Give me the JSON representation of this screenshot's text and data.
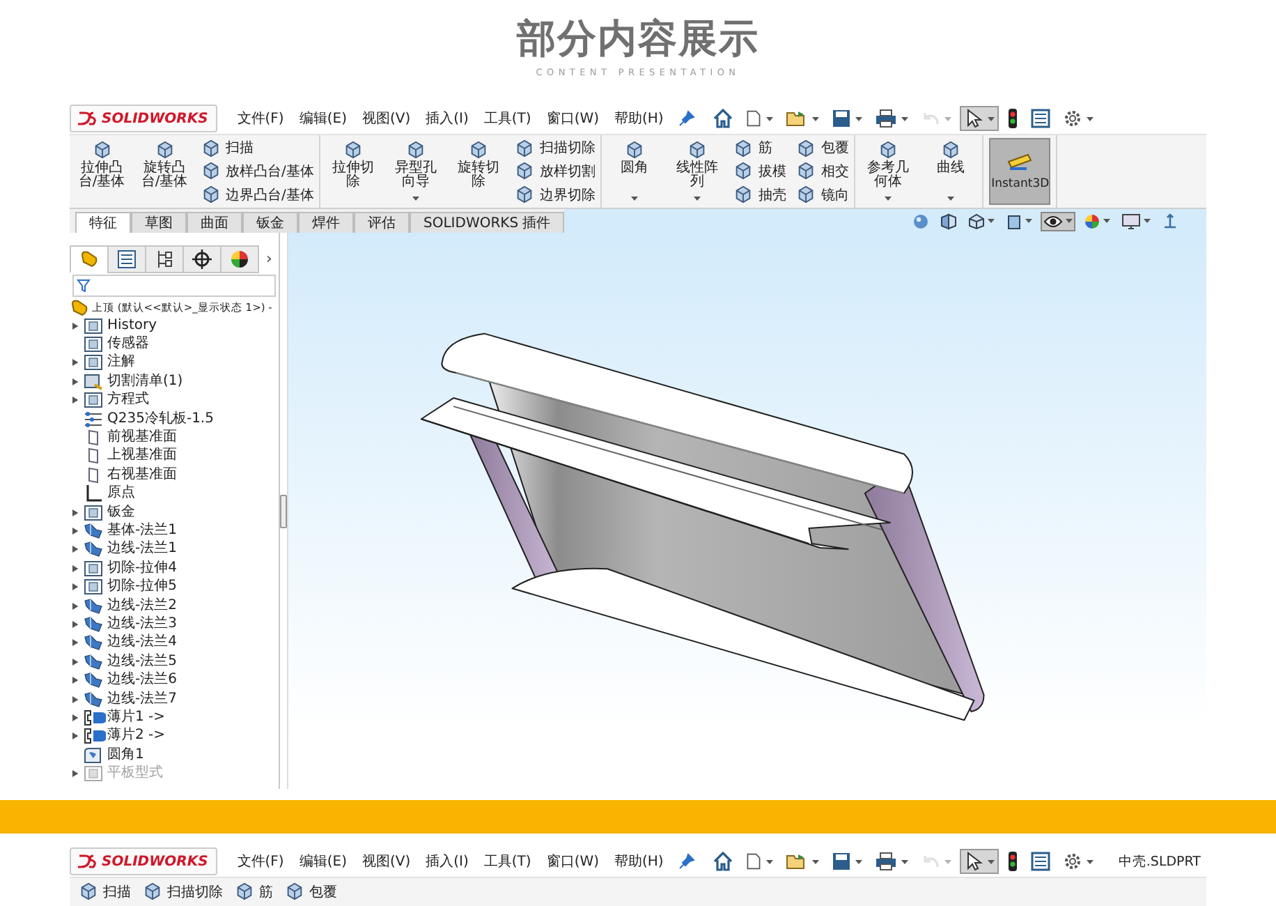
{
  "header": {
    "title": "部分内容展示",
    "subtitle": "CONTENT PRESENTATION"
  },
  "screen_1": {
    "menubar": {
      "logo": "SOLIDWORKS",
      "menus": [
        "文件(F)",
        "编辑(E)",
        "视图(V)",
        "插入(I)",
        "工具(T)",
        "窗口(W)",
        "帮助(H)"
      ],
      "quick_access": [
        {
          "kind": "home",
          "dropdown": false,
          "selected": false,
          "disabled": false
        },
        {
          "kind": "new",
          "dropdown": true,
          "selected": false,
          "disabled": false
        },
        {
          "kind": "open",
          "dropdown": true,
          "selected": false,
          "disabled": false
        },
        {
          "kind": "save",
          "dropdown": true,
          "selected": false,
          "disabled": false
        },
        {
          "kind": "print",
          "dropdown": true,
          "selected": false,
          "disabled": false
        },
        {
          "kind": "undo",
          "dropdown": true,
          "selected": false,
          "disabled": true
        },
        {
          "kind": "select",
          "dropdown": true,
          "selected": true,
          "disabled": false
        },
        {
          "kind": "rebuild",
          "dropdown": false,
          "selected": false,
          "disabled": false
        },
        {
          "kind": "file-properties",
          "dropdown": false,
          "selected": false,
          "disabled": false
        },
        {
          "kind": "options",
          "dropdown": true,
          "selected": false,
          "disabled": false
        }
      ]
    },
    "ribbon": {
      "groups": [
        {
          "columns": [
            {
              "kind": "large",
              "label": "拉伸凸台/基体",
              "dropdown": false
            },
            {
              "kind": "large",
              "label": "旋转凸台/基体",
              "dropdown": false
            },
            {
              "kind": "small",
              "items": [
                "扫描",
                "放样凸台/基体",
                "边界凸台/基体"
              ]
            }
          ]
        },
        {
          "columns": [
            {
              "kind": "large",
              "label": "拉伸切除",
              "dropdown": false
            },
            {
              "kind": "large",
              "label": "异型孔向导",
              "dropdown": true
            },
            {
              "kind": "large",
              "label": "旋转切除",
              "dropdown": false
            },
            {
              "kind": "small",
              "items": [
                "扫描切除",
                "放样切割",
                "边界切除"
              ]
            }
          ]
        },
        {
          "columns": [
            {
              "kind": "large",
              "label": "圆角",
              "dropdown": true
            },
            {
              "kind": "large",
              "label": "线性阵列",
              "dropdown": true
            },
            {
              "kind": "small",
              "items": [
                "筋",
                "拔模",
                "抽壳"
              ]
            },
            {
              "kind": "small",
              "items": [
                "包覆",
                "相交",
                "镜向"
              ]
            }
          ]
        },
        {
          "columns": [
            {
              "kind": "large",
              "label": "参考几何体",
              "dropdown": true
            },
            {
              "kind": "large",
              "label": "曲线",
              "dropdown": true
            }
          ]
        },
        {
          "columns": [
            {
              "kind": "toggle",
              "label": "Instant3D",
              "selected": true
            }
          ]
        }
      ]
    },
    "tabs": [
      {
        "label": "特征",
        "selected": true
      },
      {
        "label": "草图",
        "selected": false
      },
      {
        "label": "曲面",
        "selected": false
      },
      {
        "label": "钣金",
        "selected": false
      },
      {
        "label": "焊件",
        "selected": false
      },
      {
        "label": "评估",
        "selected": false
      },
      {
        "label": "SOLIDWORKS 插件",
        "selected": false
      }
    ],
    "view_toolbar": [
      {
        "kind": "zoom",
        "dropdown": false,
        "selected": false
      },
      {
        "kind": "section",
        "dropdown": false,
        "selected": false
      },
      {
        "kind": "orientation",
        "dropdown": true,
        "selected": false
      },
      {
        "kind": "display",
        "dropdown": true,
        "selected": false
      },
      {
        "kind": "hide-show",
        "dropdown": true,
        "selected": true
      },
      {
        "kind": "appearance",
        "dropdown": true,
        "selected": false
      },
      {
        "kind": "scene",
        "dropdown": true,
        "selected": false
      },
      {
        "kind": "triad",
        "dropdown": false,
        "selected": false
      }
    ],
    "feature_tree": {
      "panel_tabs": [
        {
          "kind": "features",
          "selected": true
        },
        {
          "kind": "properties",
          "selected": false
        },
        {
          "kind": "configurations",
          "selected": false
        },
        {
          "kind": "dimxpert",
          "selected": false
        },
        {
          "kind": "display",
          "selected": false
        }
      ],
      "more": "›",
      "root": "上顶  (默认<<默认>_显示状态 1>) -",
      "items": [
        {
          "label": "History",
          "kind": "folder",
          "expandable": true,
          "disabled": false
        },
        {
          "label": "传感器",
          "kind": "folder",
          "expandable": false,
          "disabled": false
        },
        {
          "label": "注解",
          "kind": "folder",
          "expandable": true,
          "disabled": false
        },
        {
          "label": "切割清单(1)",
          "kind": "cutlist",
          "expandable": true,
          "disabled": false
        },
        {
          "label": "方程式",
          "kind": "folder",
          "expandable": true,
          "disabled": false
        },
        {
          "label": "Q235冷轧板-1.5",
          "kind": "material",
          "expandable": false,
          "disabled": false
        },
        {
          "label": "前视基准面",
          "kind": "plane",
          "expandable": false,
          "disabled": false
        },
        {
          "label": "上视基准面",
          "kind": "plane",
          "expandable": false,
          "disabled": false
        },
        {
          "label": "右视基准面",
          "kind": "plane",
          "expandable": false,
          "disabled": false
        },
        {
          "label": "原点",
          "kind": "origin",
          "expandable": false,
          "disabled": false
        },
        {
          "label": "钣金",
          "kind": "folder",
          "expandable": true,
          "disabled": false
        },
        {
          "label": "基体-法兰1",
          "kind": "flange",
          "expandable": true,
          "disabled": false
        },
        {
          "label": "边线-法兰1",
          "kind": "flange",
          "expandable": true,
          "disabled": false
        },
        {
          "label": "切除-拉伸4",
          "kind": "folder",
          "expandable": true,
          "disabled": false
        },
        {
          "label": "切除-拉伸5",
          "kind": "folder",
          "expandable": true,
          "disabled": false
        },
        {
          "label": "边线-法兰2",
          "kind": "flange",
          "expandable": true,
          "disabled": false
        },
        {
          "label": "边线-法兰3",
          "kind": "flange",
          "expandable": true,
          "disabled": false
        },
        {
          "label": "边线-法兰4",
          "kind": "flange",
          "expandable": true,
          "disabled": false
        },
        {
          "label": "边线-法兰5",
          "kind": "flange",
          "expandable": true,
          "disabled": false
        },
        {
          "label": "边线-法兰6",
          "kind": "flange",
          "expandable": true,
          "disabled": false
        },
        {
          "label": "边线-法兰7",
          "kind": "flange",
          "expandable": true,
          "disabled": false
        },
        {
          "label": "薄片1 ->",
          "kind": "tab",
          "expandable": true,
          "disabled": false
        },
        {
          "label": "薄片2 ->",
          "kind": "tab",
          "expandable": true,
          "disabled": false
        },
        {
          "label": "圆角1",
          "kind": "fillet",
          "expandable": false,
          "disabled": false
        },
        {
          "label": "平板型式",
          "kind": "folder",
          "expandable": true,
          "disabled": true
        }
      ]
    }
  },
  "screen_2": {
    "menubar": {
      "logo": "SOLIDWORKS",
      "menus": [
        "文件(F)",
        "编辑(E)",
        "视图(V)",
        "插入(I)",
        "工具(T)",
        "窗口(W)",
        "帮助(H)"
      ],
      "quick_access": [
        {
          "kind": "home",
          "dropdown": false,
          "selected": false,
          "disabled": false
        },
        {
          "kind": "new",
          "dropdown": true,
          "selected": false,
          "disabled": false
        },
        {
          "kind": "open",
          "dropdown": true,
          "selected": false,
          "disabled": false
        },
        {
          "kind": "save",
          "dropdown": true,
          "selected": false,
          "disabled": false
        },
        {
          "kind": "print",
          "dropdown": true,
          "selected": false,
          "disabled": false
        },
        {
          "kind": "undo",
          "dropdown": true,
          "selected": false,
          "disabled": true
        },
        {
          "kind": "select",
          "dropdown": true,
          "selected": true,
          "disabled": false
        },
        {
          "kind": "rebuild",
          "dropdown": false,
          "selected": false,
          "disabled": false
        },
        {
          "kind": "file-properties",
          "dropdown": false,
          "selected": false,
          "disabled": false
        },
        {
          "kind": "options",
          "dropdown": true,
          "selected": false,
          "disabled": false
        }
      ],
      "document_title": "中壳.SLDPRT"
    },
    "ribbon_labels": [
      "扫描",
      "扫描切除",
      "筋",
      "包覆"
    ]
  }
}
